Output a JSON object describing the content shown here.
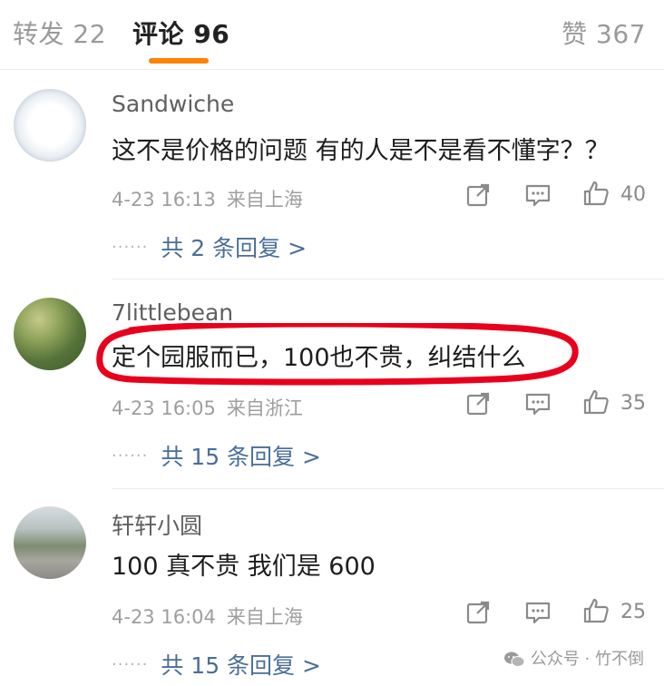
{
  "tabs": {
    "reposts": "转发 22",
    "comments": "评论 96",
    "likes": "赞 367"
  },
  "comments": [
    {
      "username": "Sandwiche",
      "text": "这不是价格的问题 有的人是不是看不懂字？？",
      "time": "4-23 16:13",
      "location": "来自上海",
      "likes": "40",
      "replies": "共 2 条回复 >"
    },
    {
      "username": "7littlebean",
      "text": "定个园服而已，100也不贵，纠结什么",
      "time": "4-23 16:05",
      "location": "来自浙江",
      "likes": "35",
      "replies": "共 15 条回复 >"
    },
    {
      "username": "轩轩小圆",
      "text": "100 真不贵 我们是 600",
      "time": "4-23 16:04",
      "location": "来自上海",
      "likes": "25",
      "replies": "共 15 条回复 >"
    }
  ],
  "reply_dots": "······",
  "watermark": "公众号 · 竹不倒",
  "colors": {
    "accent": "#ff8200",
    "link": "#4a6e98",
    "annotation": "#e8001c"
  },
  "icons": [
    "share-icon",
    "comment-icon",
    "like-icon",
    "wechat-icon"
  ]
}
